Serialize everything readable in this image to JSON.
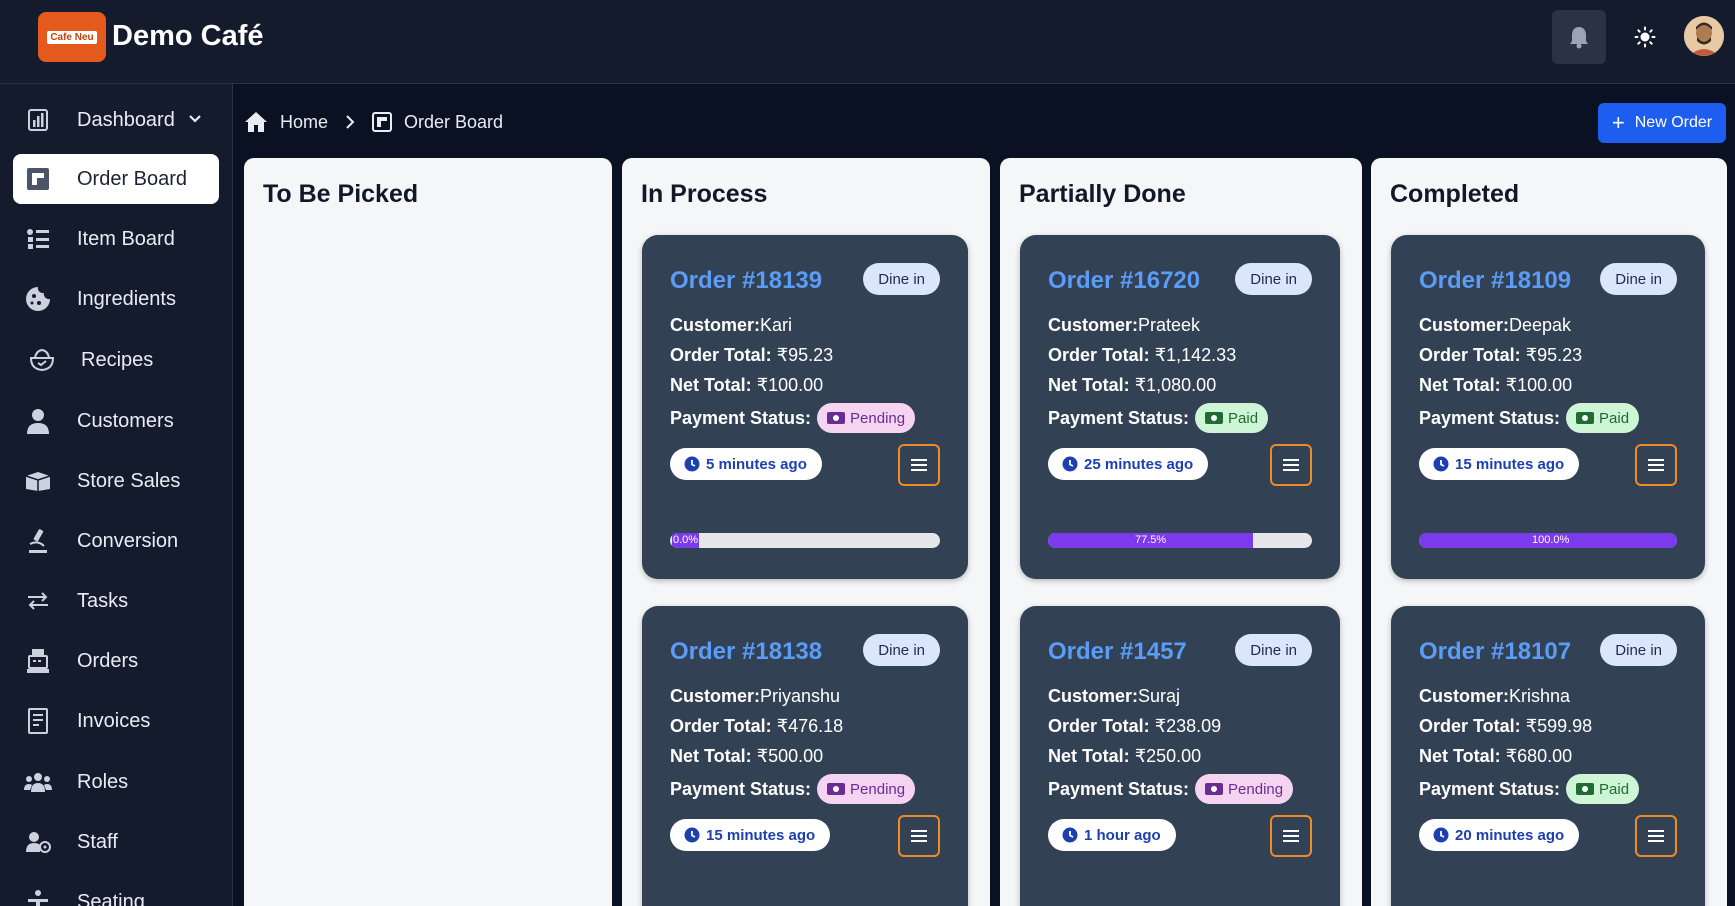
{
  "app": {
    "logo_text": "Cafe Neu",
    "title": "Demo Café"
  },
  "sidebar": {
    "items": [
      {
        "label": "Dashboard",
        "icon": "chart-icon"
      },
      {
        "label": "Order Board",
        "icon": "board-icon"
      },
      {
        "label": "Item Board",
        "icon": "list-icon"
      },
      {
        "label": "Ingredients",
        "icon": "cookie-icon"
      },
      {
        "label": "Recipes",
        "icon": "bowl-icon"
      },
      {
        "label": "Customers",
        "icon": "person-icon"
      },
      {
        "label": "Store Sales",
        "icon": "box-icon"
      },
      {
        "label": "Conversion",
        "icon": "microscope-icon"
      },
      {
        "label": "Tasks",
        "icon": "swap-icon"
      },
      {
        "label": "Orders",
        "icon": "register-icon"
      },
      {
        "label": "Invoices",
        "icon": "receipt-icon"
      },
      {
        "label": "Roles",
        "icon": "group-icon"
      },
      {
        "label": "Staff",
        "icon": "staff-icon"
      },
      {
        "label": "Seating",
        "icon": "seating-icon"
      }
    ]
  },
  "breadcrumb": {
    "home": "Home",
    "current": "Order Board"
  },
  "toolbar": {
    "new_order_label": "New Order"
  },
  "labels": {
    "customer": "Customer:",
    "order_total": "Order Total:",
    "net_total": "Net Total:",
    "payment_status": "Payment Status:"
  },
  "columns": [
    {
      "title": "To Be Picked",
      "cards": []
    },
    {
      "title": "In Process",
      "cards": [
        {
          "order": "Order #18139",
          "type": "Dine in",
          "customer": "Kari",
          "order_total": "₹95.23",
          "net_total": "₹100.00",
          "payment": "Pending",
          "time": "5 minutes ago",
          "progress": 0.0,
          "progress_label": "0.0%"
        },
        {
          "order": "Order #18138",
          "type": "Dine in",
          "customer": "Priyanshu",
          "order_total": "₹476.18",
          "net_total": "₹500.00",
          "payment": "Pending",
          "time": "15 minutes ago"
        }
      ]
    },
    {
      "title": "Partially Done",
      "cards": [
        {
          "order": "Order #16720",
          "type": "Dine in",
          "customer": "Prateek",
          "order_total": "₹1,142.33",
          "net_total": "₹1,080.00",
          "payment": "Paid",
          "time": "25 minutes ago",
          "progress": 77.5,
          "progress_label": "77.5%"
        },
        {
          "order": "Order #1457",
          "type": "Dine in",
          "customer": "Suraj",
          "order_total": "₹238.09",
          "net_total": "₹250.00",
          "payment": "Pending",
          "time": "1 hour ago"
        }
      ]
    },
    {
      "title": "Completed",
      "cards": [
        {
          "order": "Order #18109",
          "type": "Dine in",
          "customer": "Deepak",
          "order_total": "₹95.23",
          "net_total": "₹100.00",
          "payment": "Paid",
          "time": "15 minutes ago",
          "progress": 100.0,
          "progress_label": "100.0%"
        },
        {
          "order": "Order #18107",
          "type": "Dine in",
          "customer": "Krishna",
          "order_total": "₹599.98",
          "net_total": "₹680.00",
          "payment": "Paid",
          "time": "20 minutes ago"
        }
      ]
    }
  ],
  "colors": {
    "accent": "#1d5ef0",
    "order_title": "#5b9cf6",
    "progress": "#7c3aed",
    "menu_border": "#f08a24"
  }
}
